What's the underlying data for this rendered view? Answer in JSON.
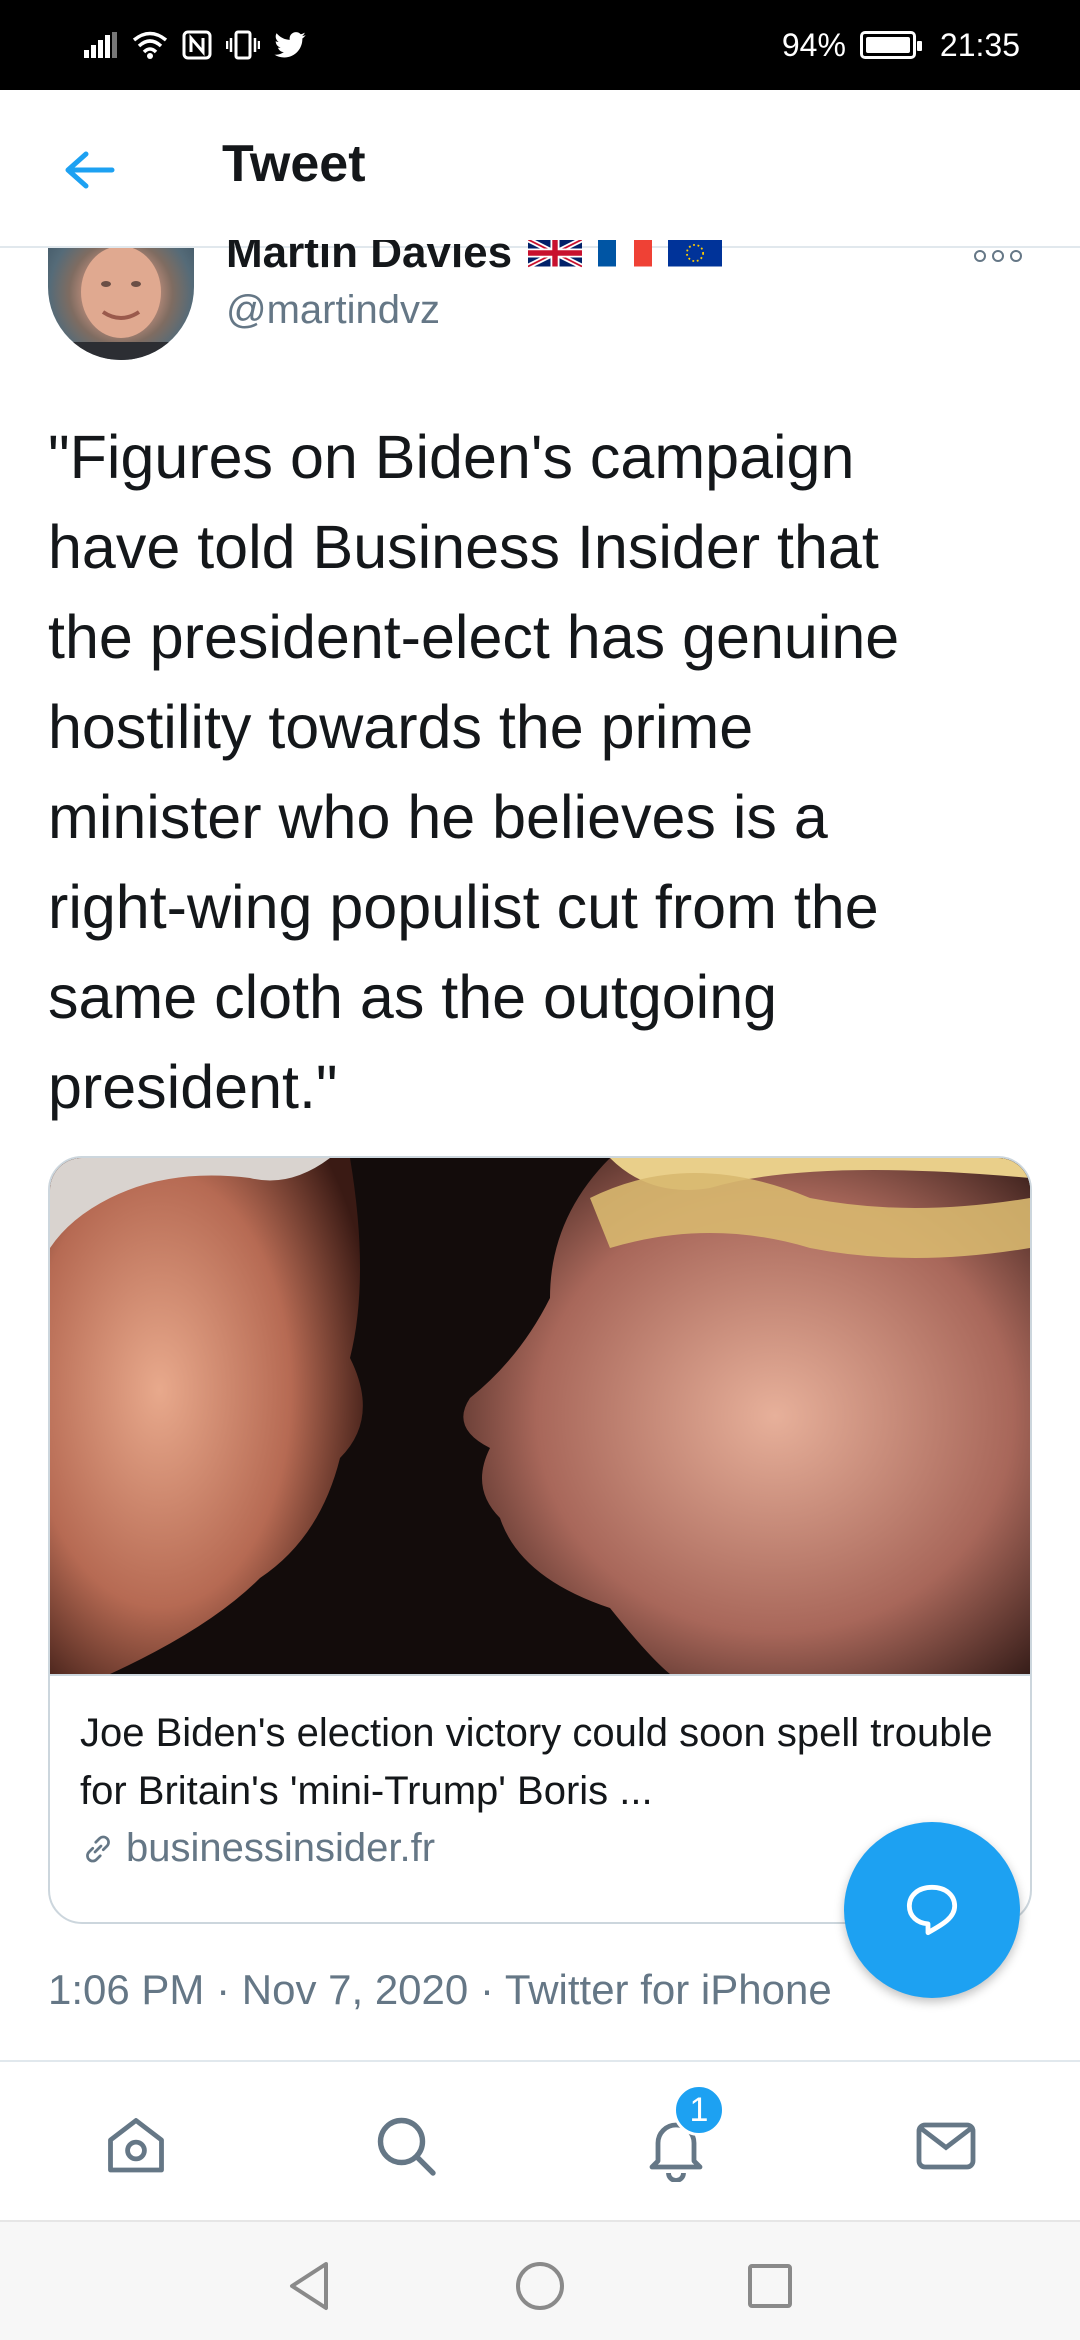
{
  "status_bar": {
    "battery_percent": "94%",
    "time": "21:35",
    "icons": [
      "signal-icon",
      "wifi-icon",
      "nfc-icon",
      "vibrate-icon",
      "twitter-icon",
      "battery-icon"
    ]
  },
  "header": {
    "back_icon": "arrow-left-icon",
    "title": "Tweet"
  },
  "tweet": {
    "author": {
      "name": "Martin Davies",
      "flags": [
        "uk-flag-icon",
        "france-flag-icon",
        "eu-flag-icon"
      ],
      "handle": "@martindvz"
    },
    "text": "\"Figures on Biden's campaign\nhave told Business Insider that\nthe president-elect has genuine\nhostility towards the prime\nminister who he believes is a\nright-wing populist cut from the\nsame cloth as the outgoing\npresident.\"",
    "card": {
      "title": "Joe Biden's election victory could soon spell trouble for Britain's 'mini-Trump' Boris ...",
      "domain": "businessinsider.fr",
      "link_icon": "link-icon"
    },
    "meta": {
      "time": "1:06 PM",
      "separator": "·",
      "date": "Nov 7, 2020",
      "source": "Twitter for iPhone"
    }
  },
  "fab": {
    "icon": "reply-bubble-icon"
  },
  "bottom_nav": {
    "items": [
      "home-icon",
      "search-icon",
      "notifications-icon",
      "messages-icon"
    ],
    "notifications_badge": "1"
  },
  "system_nav": [
    "back-triangle-icon",
    "home-circle-icon",
    "recents-square-icon"
  ],
  "colors": {
    "accent": "#1da1f2",
    "text_primary": "#14171a",
    "text_secondary": "#657786",
    "border": "#e1e8ed"
  }
}
